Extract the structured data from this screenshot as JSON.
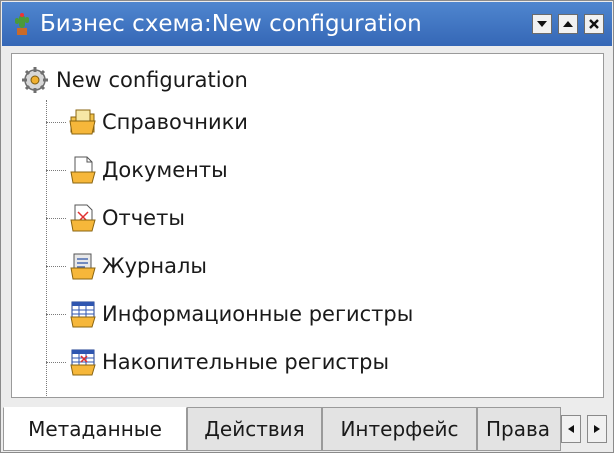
{
  "window": {
    "title": "Бизнес схема:New configuration",
    "app_icon": "cactus-icon",
    "buttons": [
      "minimize-icon",
      "maximize-icon",
      "close-icon"
    ],
    "title_bar_color": "#3f74c3"
  },
  "tree": {
    "root": {
      "label": "New configuration",
      "icon": "gears-icon"
    },
    "items": [
      {
        "label": "Справочники",
        "icon": "catalog-folder-icon"
      },
      {
        "label": "Документы",
        "icon": "document-folder-icon"
      },
      {
        "label": "Отчеты",
        "icon": "report-folder-icon"
      },
      {
        "label": "Журналы",
        "icon": "journal-folder-icon"
      },
      {
        "label": "Информационные регистры",
        "icon": "info-register-folder-icon"
      },
      {
        "label": "Накопительные регистры",
        "icon": "accumulation-register-folder-icon"
      }
    ]
  },
  "tabs": [
    {
      "label": "Метаданные",
      "active": true
    },
    {
      "label": "Действия",
      "active": false
    },
    {
      "label": "Интерфейс",
      "active": false
    },
    {
      "label": "Права",
      "active": false
    }
  ],
  "tab_scroll": [
    "scroll-left-icon",
    "scroll-right-icon"
  ]
}
